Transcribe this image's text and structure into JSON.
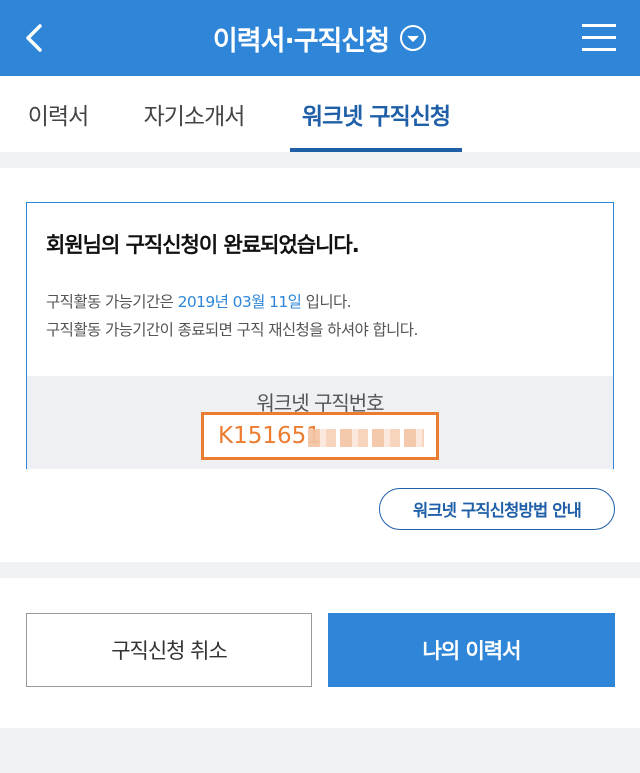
{
  "header": {
    "back_icon": "chevron-left-icon",
    "title": "이력서·구직신청",
    "dropdown_icon": "chevron-down-circle-icon",
    "menu_icon": "hamburger-menu-icon",
    "color": "#2f86d9"
  },
  "tabs": [
    {
      "label": "이력서",
      "active": false
    },
    {
      "label": "자기소개서",
      "active": false
    },
    {
      "label": "워크넷 구직신청",
      "active": true
    }
  ],
  "card": {
    "title": "회원님의 구직신청이 완료되었습니다.",
    "line1_prefix": "구직활동 가능기간은 ",
    "line1_date": "2019년 03월 11일",
    "line1_suffix": " 입니다.",
    "line2": "구직활동 가능기간이 종료되면 구직 재신청을 하셔야 합니다.",
    "job_label": "워크넷 구직번호",
    "job_number_visible": "K151651"
  },
  "guide_button": "워크넷 구직신청방법 안내",
  "actions": {
    "cancel_label": "구직신청 취소",
    "resume_label": "나의 이력서"
  },
  "colors": {
    "accent": "#2f86d9",
    "tab_active": "#1f5fa8",
    "highlight_border": "#ec7c30"
  }
}
